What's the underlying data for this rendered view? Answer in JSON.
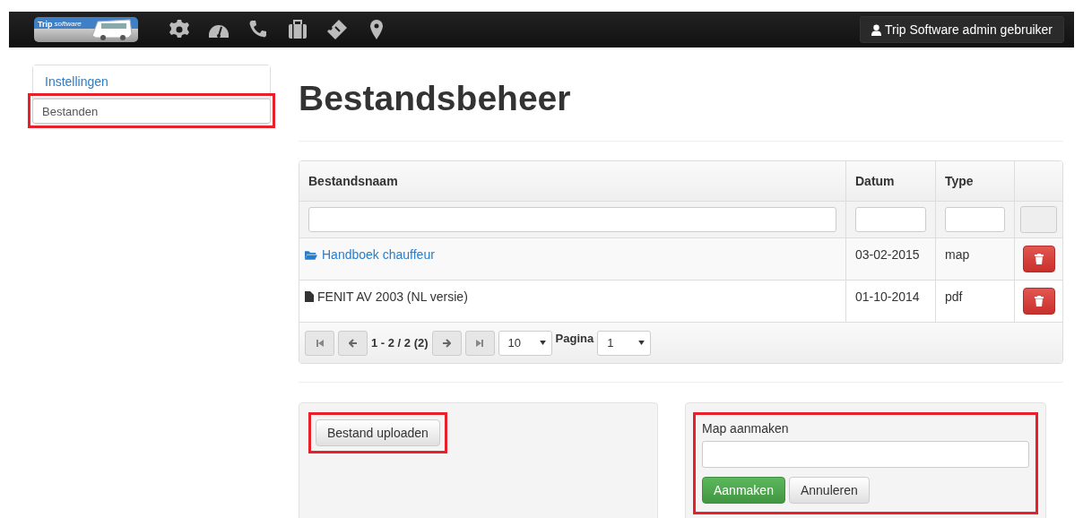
{
  "navbar": {
    "logo": {
      "word_1": "Trip",
      "word_2": "software"
    },
    "icons": [
      {
        "kind": "gear"
      },
      {
        "kind": "gauge"
      },
      {
        "kind": "phone"
      },
      {
        "kind": "briefcase"
      },
      {
        "kind": "ticket"
      },
      {
        "kind": "pin"
      }
    ],
    "user_button": "Trip Software admin gebruiker"
  },
  "sidebar": {
    "items": [
      {
        "label": "Instellingen",
        "selected": false,
        "highlighted": false
      },
      {
        "label": "Bestanden",
        "selected": true,
        "highlighted": true
      }
    ]
  },
  "page_title": "Bestandsbeheer",
  "table": {
    "columns": [
      "Bestandsnaam",
      "Datum",
      "Type"
    ],
    "rows": [
      {
        "kind": "folder",
        "name": "Handboek chauffeur",
        "date": "03-02-2015",
        "type": "map"
      },
      {
        "kind": "file",
        "name": "FENIT AV 2003 (NL versie)",
        "date": "01-10-2014",
        "type": "pdf"
      }
    ],
    "pagination": {
      "range": "1 - 2 / 2 (2)",
      "page_size": "10",
      "page_label": "Pagina",
      "page": "1"
    }
  },
  "upload_panel": {
    "button": "Bestand uploaden",
    "highlighted": true
  },
  "folder_panel": {
    "label": "Map aanmaken",
    "create_button": "Aanmaken",
    "cancel_button": "Annuleren",
    "highlighted": true
  }
}
